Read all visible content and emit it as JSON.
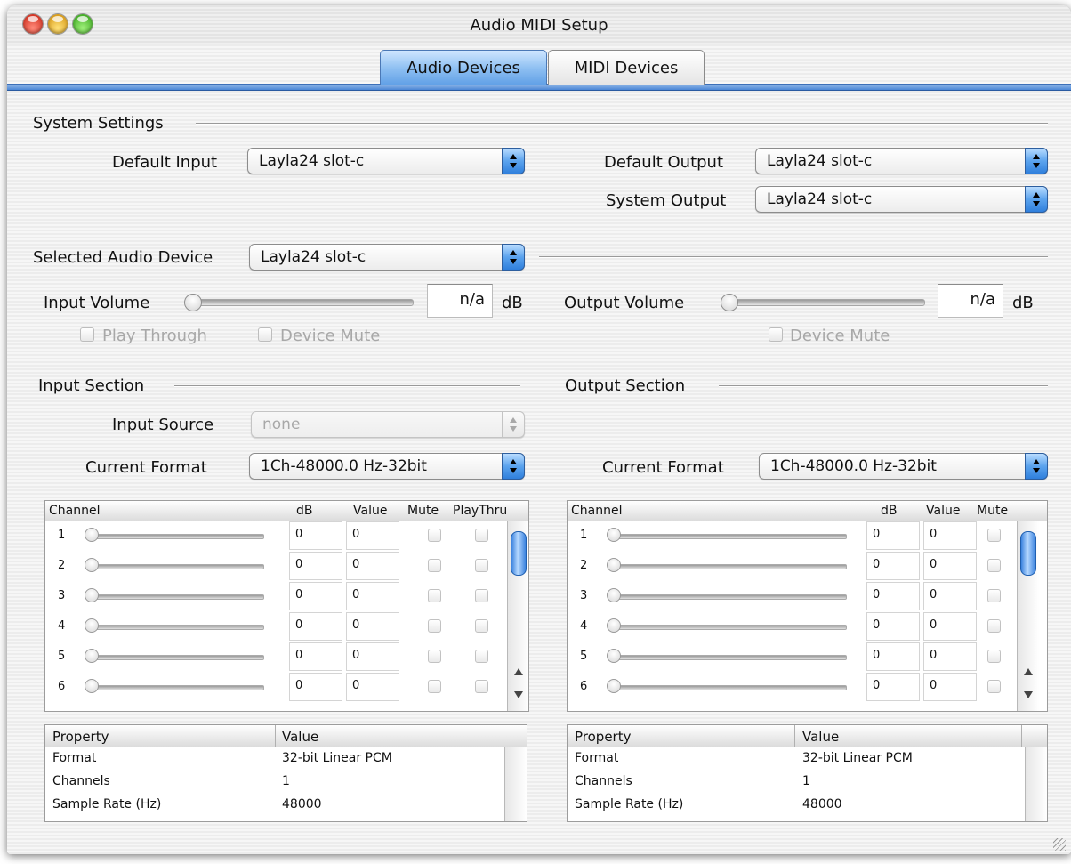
{
  "window": {
    "title": "Audio MIDI Setup"
  },
  "tabs": [
    {
      "label": "Audio Devices",
      "active": true
    },
    {
      "label": "MIDI Devices",
      "active": false
    }
  ],
  "system_settings": {
    "heading": "System Settings",
    "default_input": {
      "label": "Default Input",
      "value": "Layla24 slot-c"
    },
    "default_output": {
      "label": "Default Output",
      "value": "Layla24 slot-c"
    },
    "system_output": {
      "label": "System Output",
      "value": "Layla24 slot-c"
    }
  },
  "selected_device": {
    "label": "Selected Audio Device",
    "value": "Layla24 slot-c"
  },
  "input_volume": {
    "label": "Input Volume",
    "value": "n/a",
    "unit": "dB",
    "play_through": "Play Through",
    "device_mute": "Device Mute"
  },
  "output_volume": {
    "label": "Output Volume",
    "value": "n/a",
    "unit": "dB",
    "device_mute": "Device Mute"
  },
  "input_section": {
    "heading": "Input Section",
    "source_label": "Input Source",
    "source_value": "none",
    "format_label": "Current Format",
    "format_value": "1Ch-48000.0 Hz-32bit",
    "columns": [
      "Channel",
      "dB",
      "Value",
      "Mute",
      "PlayThru"
    ],
    "rows": [
      {
        "ch": "1",
        "db": "0",
        "val": "0"
      },
      {
        "ch": "2",
        "db": "0",
        "val": "0"
      },
      {
        "ch": "3",
        "db": "0",
        "val": "0"
      },
      {
        "ch": "4",
        "db": "0",
        "val": "0"
      },
      {
        "ch": "5",
        "db": "0",
        "val": "0"
      },
      {
        "ch": "6",
        "db": "0",
        "val": "0"
      }
    ],
    "props_header": [
      "Property",
      "Value"
    ],
    "props": [
      {
        "k": "Format",
        "v": "32-bit Linear PCM"
      },
      {
        "k": "Channels",
        "v": "1"
      },
      {
        "k": "Sample Rate (Hz)",
        "v": "48000"
      }
    ]
  },
  "output_section": {
    "heading": "Output Section",
    "format_label": "Current Format",
    "format_value": "1Ch-48000.0 Hz-32bit",
    "columns": [
      "Channel",
      "dB",
      "Value",
      "Mute"
    ],
    "rows": [
      {
        "ch": "1",
        "db": "0",
        "val": "0"
      },
      {
        "ch": "2",
        "db": "0",
        "val": "0"
      },
      {
        "ch": "3",
        "db": "0",
        "val": "0"
      },
      {
        "ch": "4",
        "db": "0",
        "val": "0"
      },
      {
        "ch": "5",
        "db": "0",
        "val": "0"
      },
      {
        "ch": "6",
        "db": "0",
        "val": "0"
      }
    ],
    "props_header": [
      "Property",
      "Value"
    ],
    "props": [
      {
        "k": "Format",
        "v": "32-bit Linear PCM"
      },
      {
        "k": "Channels",
        "v": "1"
      },
      {
        "k": "Sample Rate (Hz)",
        "v": "48000"
      }
    ]
  }
}
